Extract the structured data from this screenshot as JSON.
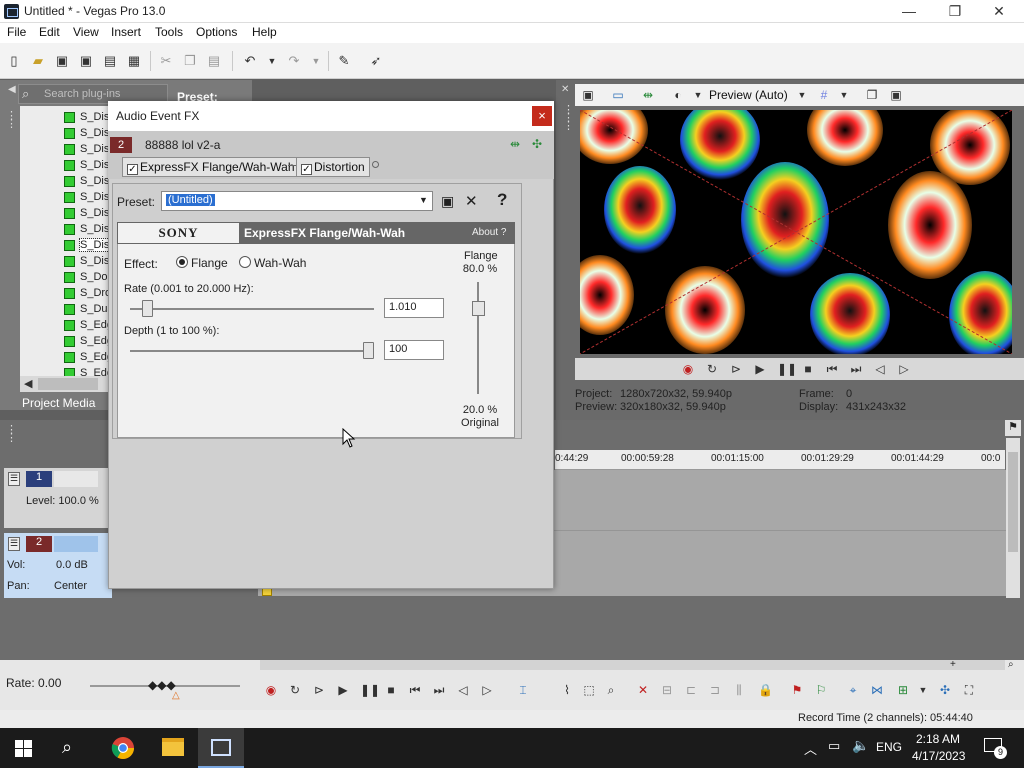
{
  "app": {
    "title": "Untitled * - Vegas Pro 13.0",
    "min": "—",
    "max": "❐",
    "close": "✕"
  },
  "menu": [
    "File",
    "Edit",
    "View",
    "Insert",
    "Tools",
    "Options",
    "Help"
  ],
  "left_panel": {
    "search_placeholder": "Search plug-ins",
    "preset_label": "Preset:",
    "tree_items": [
      "S_Dis",
      "S_Dis",
      "S_Dis",
      "S_Dis",
      "S_Dis",
      "S_Dis",
      "S_Dis",
      "S_Dis",
      "S_Dis",
      "S_Dis",
      "S_Doo",
      "S_Dro",
      "S_Dus",
      "S_Edg",
      "S_Edg",
      "S_Edg",
      "S_Edg",
      "S_Edg"
    ],
    "selected_index": 8,
    "tab_label": "Project Media"
  },
  "preview": {
    "mode": "Preview (Auto)",
    "project_label": "Project:",
    "project_value": "1280x720x32, 59.940p",
    "preview_label": "Preview:",
    "preview_value": "320x180x32, 59.940p",
    "frame_label": "Frame:",
    "frame_value": "0",
    "display_label": "Display:",
    "display_value": "431x243x32"
  },
  "timeline": {
    "ticks": [
      "0:44:29",
      "00:00:59:28",
      "00:01:15:00",
      "00:01:29:29",
      "00:01:44:29",
      "00:0"
    ],
    "track1_num": "1",
    "track1_level": "Level: 100.0 %",
    "track2_num": "2",
    "track2_vol_label": "Vol:",
    "track2_vol": "0.0 dB",
    "track2_pan_label": "Pan:",
    "track2_pan": "Center",
    "rate": "Rate: 0.00",
    "record_time": "Record Time (2 channels): 05:44:40"
  },
  "dialog": {
    "title": "Audio Event FX",
    "close": "×",
    "event_num": "2",
    "event_name": "88888 lol v2-a",
    "chain": [
      "ExpressFX Flange/Wah-Wah",
      "Distortion"
    ],
    "preset_label": "Preset:",
    "preset_value": "(Untitled)",
    "help": "?",
    "plugin": {
      "brand": "SONY",
      "name": "ExpressFX Flange/Wah-Wah",
      "about": "About  ?",
      "effect_label": "Effect:",
      "effect_options": [
        "Flange",
        "Wah-Wah"
      ],
      "effect_selected": "Flange",
      "rate_label": "Rate (0.001 to 20.000 Hz):",
      "rate_value": "1.010",
      "rate_fraction": 0.05,
      "depth_label": "Depth (1 to 100 %):",
      "depth_value": "100",
      "depth_fraction": 1.0,
      "mix_top_label": "Flange",
      "mix_top_value": "80.0 %",
      "mix_bottom_value": "20.0 %",
      "mix_bottom_label": "Original",
      "mix_fraction": 0.8
    }
  },
  "taskbar": {
    "time": "2:18 AM",
    "date": "4/17/2023",
    "lang": "ENG",
    "notif": "9"
  }
}
